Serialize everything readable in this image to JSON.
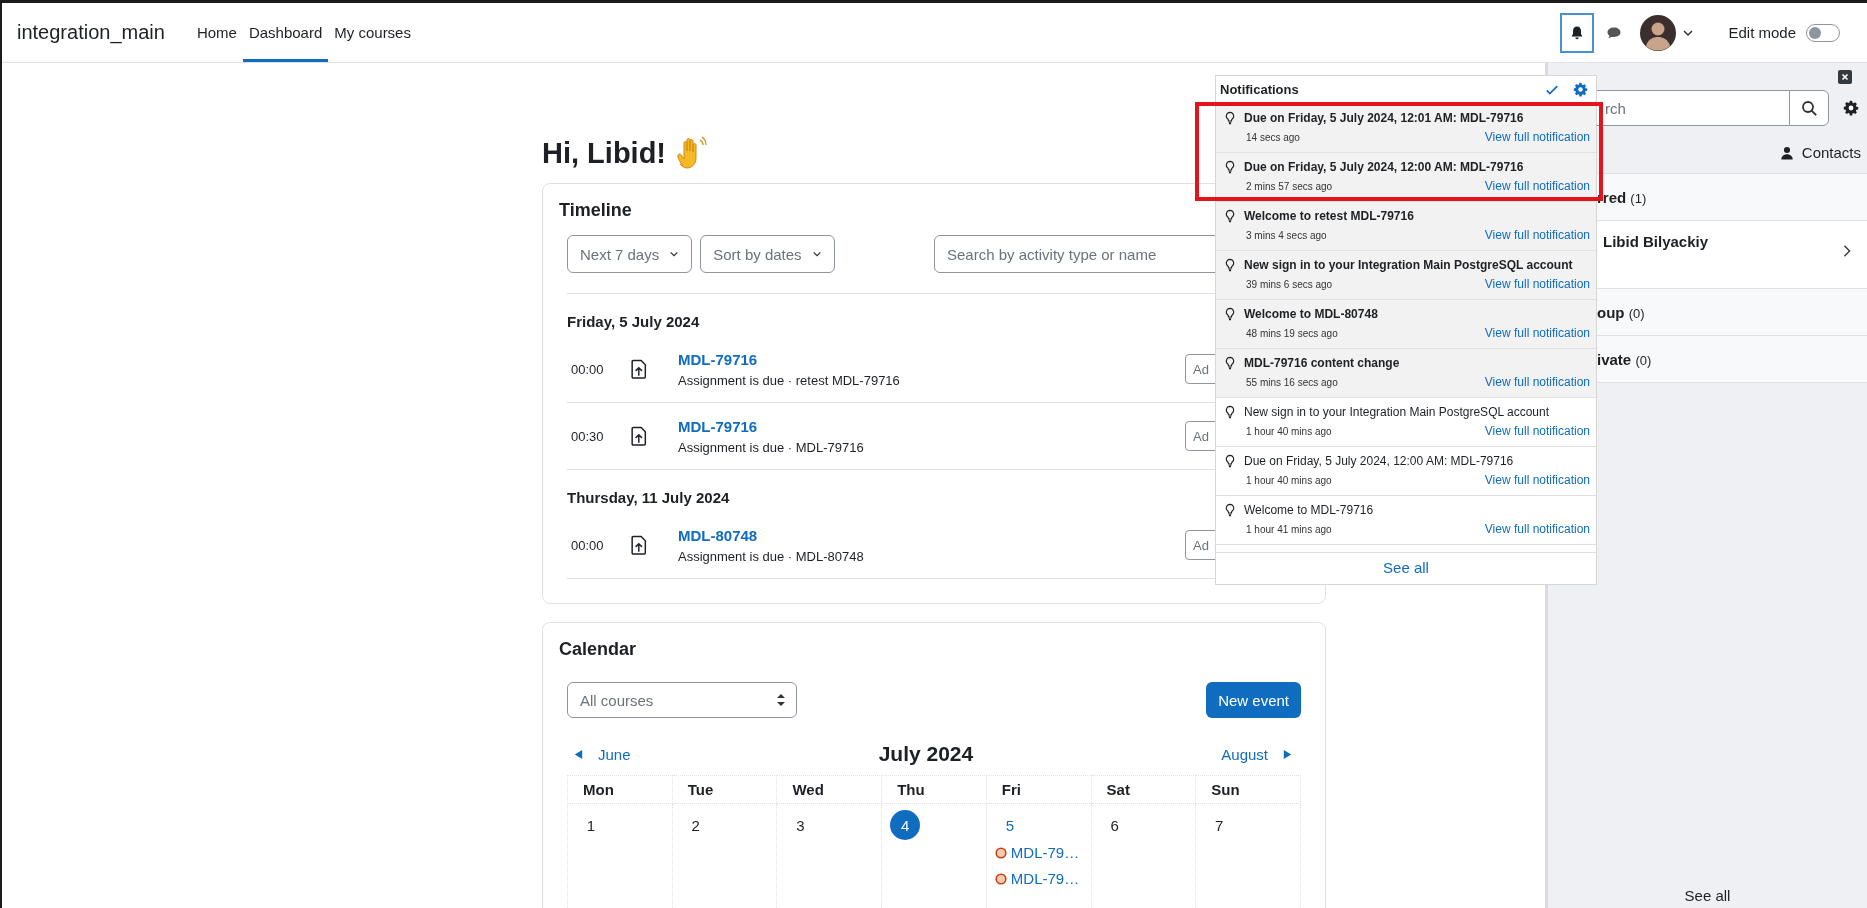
{
  "header": {
    "site_name": "integration_main",
    "nav": [
      {
        "label": "Home",
        "selected": false
      },
      {
        "label": "Dashboard",
        "selected": true
      },
      {
        "label": "My courses",
        "selected": false
      }
    ],
    "edit_mode": {
      "label": "Edit mode",
      "on": false
    }
  },
  "greeting": "Hi, Libid!",
  "timeline": {
    "title": "Timeline",
    "filters": [
      "Next 7 days",
      "Sort by dates"
    ],
    "search": {
      "placeholder": "Search by activity type or name"
    },
    "groups": [
      {
        "date": "Friday, 5 July 2024",
        "events": [
          {
            "time": "00:00",
            "name": "MDL-79716",
            "subtitle": "Assignment is due · retest MDL-79716",
            "action": "Ad"
          },
          {
            "time": "00:30",
            "name": "MDL-79716",
            "subtitle": "Assignment is due · MDL-79716",
            "action": "Ad"
          }
        ]
      },
      {
        "date": "Thursday, 11 July 2024",
        "events": [
          {
            "time": "00:00",
            "name": "MDL-80748",
            "subtitle": "Assignment is due · MDL-80748",
            "action": "Ad"
          }
        ]
      }
    ]
  },
  "calendar": {
    "title": "Calendar",
    "course_select": "All courses",
    "new_event": "New event",
    "prev": "June",
    "month": "July 2024",
    "next": "August",
    "weekdays": [
      "Mon",
      "Tue",
      "Wed",
      "Thu",
      "Fri",
      "Sat",
      "Sun"
    ],
    "days": [
      {
        "label": "1",
        "today": false
      },
      {
        "label": "2",
        "today": false
      },
      {
        "label": "3",
        "today": false
      },
      {
        "label": "4",
        "today": true
      },
      {
        "label": "5",
        "today": false,
        "events": [
          "MDL-79…",
          "MDL-79…"
        ]
      },
      {
        "label": "6",
        "today": false
      },
      {
        "label": "7",
        "today": false
      }
    ]
  },
  "notifications": {
    "title": "Notifications",
    "items": [
      {
        "title": "Due on Friday, 5 July 2024, 12:01 AM: MDL-79716",
        "time": "14 secs ago",
        "unread": true,
        "link": "View full notification"
      },
      {
        "title": "Due on Friday, 5 July 2024, 12:00 AM: MDL-79716",
        "time": "2 mins 57 secs ago",
        "unread": true,
        "link": "View full notification"
      },
      {
        "title": "Welcome to retest MDL-79716",
        "time": "3 mins 4 secs ago",
        "unread": true,
        "link": "View full notification"
      },
      {
        "title": "New sign in to your Integration Main PostgreSQL account",
        "time": "39 mins 6 secs ago",
        "unread": true,
        "link": "View full notification"
      },
      {
        "title": "Welcome to MDL-80748",
        "time": "48 mins 19 secs ago",
        "unread": true,
        "link": "View full notification"
      },
      {
        "title": "MDL-79716 content change",
        "time": "55 mins 16 secs ago",
        "unread": true,
        "link": "View full notification"
      },
      {
        "title": "New sign in to your Integration Main PostgreSQL account",
        "time": "1 hour 40 mins ago",
        "unread": false,
        "link": "View full notification"
      },
      {
        "title": "Due on Friday, 5 July 2024, 12:00 AM: MDL-79716",
        "time": "1 hour 40 mins ago",
        "unread": false,
        "link": "View full notification"
      },
      {
        "title": "Welcome to MDL-79716",
        "time": "1 hour 41 mins ago",
        "unread": false,
        "link": "View full notification"
      }
    ],
    "see_all": "See all"
  },
  "drawer": {
    "search": {
      "placeholder": "rch"
    },
    "heading": "Contacts",
    "sections": [
      {
        "label": "rred",
        "count": "(1)",
        "contacts": [
          {
            "name": "Libid Bilyackiy"
          }
        ]
      },
      {
        "label": "oup",
        "count": "(0)"
      },
      {
        "label": "ivate",
        "count": "(0)"
      }
    ],
    "see_all": "See all"
  }
}
